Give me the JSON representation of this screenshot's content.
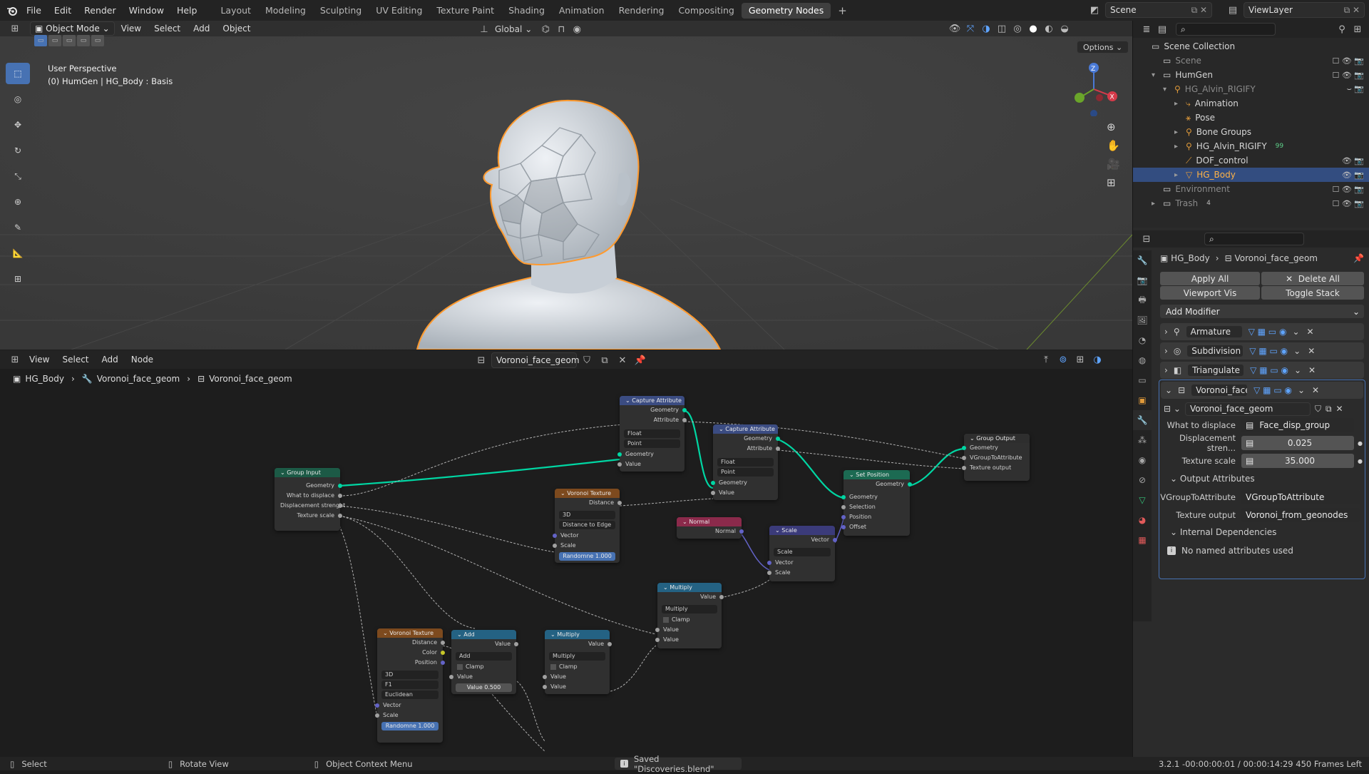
{
  "topbar": {
    "menus": [
      "File",
      "Edit",
      "Render",
      "Window",
      "Help"
    ],
    "workspaces": [
      "Layout",
      "Modeling",
      "Sculpting",
      "UV Editing",
      "Texture Paint",
      "Shading",
      "Animation",
      "Rendering",
      "Compositing",
      "Geometry Nodes"
    ],
    "active_workspace": "Geometry Nodes",
    "add_workspace": "+",
    "scene": "Scene",
    "view_layer": "ViewLayer"
  },
  "viewport": {
    "mode": "Object Mode",
    "menus": [
      "View",
      "Select",
      "Add",
      "Object"
    ],
    "orientation": "Global",
    "options": "Options",
    "overlay_line1": "User Perspective",
    "overlay_line2": "(0) HumGen | HG_Body : Basis"
  },
  "node_editor": {
    "menus": [
      "View",
      "Select",
      "Add",
      "Node"
    ],
    "tree_name": "Voronoi_face_geom",
    "breadcrumb": [
      "HG_Body",
      "Voronoi_face_geom",
      "Voronoi_face_geom"
    ]
  },
  "nodes": {
    "group_input": {
      "title": "Group Input",
      "outputs": [
        "Geometry",
        "What to displace",
        "Displacement strenght",
        "Texture scale"
      ]
    },
    "capture1": {
      "title": "Capture Attribute",
      "outputs": [
        "Geometry",
        "Attribute"
      ],
      "type": "Float",
      "domain": "Point",
      "inputs": [
        "Geometry",
        "Value"
      ]
    },
    "capture2": {
      "title": "Capture Attribute",
      "outputs": [
        "Geometry",
        "Attribute"
      ],
      "type": "Float",
      "domain": "Point",
      "inputs": [
        "Geometry",
        "Value"
      ]
    },
    "group_output": {
      "title": "Group Output",
      "inputs": [
        "Geometry",
        "VGroupToAttribute",
        "Texture output"
      ]
    },
    "voronoi1": {
      "title": "Voronoi Texture",
      "outputs": [
        "Distance"
      ],
      "dims": "3D",
      "feature": "Distance to Edge",
      "inputs": [
        "Vector",
        "Scale"
      ],
      "randomness": "Randomne  1.000"
    },
    "set_position": {
      "title": "Set Position",
      "outputs": [
        "Geometry"
      ],
      "inputs": [
        "Geometry",
        "Selection",
        "Position",
        "Offset"
      ]
    },
    "normal": {
      "title": "Normal",
      "outputs": [
        "Normal"
      ]
    },
    "scale": {
      "title": "Scale",
      "outputs": [
        "Vector"
      ],
      "op": "Scale",
      "inputs": [
        "Vector",
        "Scale"
      ]
    },
    "multiply_top": {
      "title": "Multiply",
      "outputs": [
        "Value"
      ],
      "op": "Multiply",
      "clamp": "Clamp",
      "inputs": [
        "Value",
        "Value"
      ]
    },
    "voronoi2": {
      "title": "Voronoi Texture",
      "outputs": [
        "Distance",
        "Color",
        "Position"
      ],
      "dims": "3D",
      "feature": "F1",
      "metric": "Euclidean",
      "inputs": [
        "Vector",
        "Scale"
      ],
      "randomness": "Randomne  1.000"
    },
    "add": {
      "title": "Add",
      "outputs": [
        "Value"
      ],
      "op": "Add",
      "clamp": "Clamp",
      "inputs": [
        "Value"
      ],
      "value": "Value   0.500"
    },
    "multiply_bottom": {
      "title": "Multiply",
      "outputs": [
        "Value"
      ],
      "op": "Multiply",
      "clamp": "Clamp",
      "inputs": [
        "Value",
        "Value"
      ]
    }
  },
  "outliner": {
    "rows": [
      {
        "label": "Scene Collection",
        "indent": 0,
        "icon": "collection-icon"
      },
      {
        "label": "Scene",
        "indent": 1,
        "icon": "collection-icon",
        "dim": true
      },
      {
        "label": "HumGen",
        "indent": 1,
        "icon": "collection-icon",
        "exp": "▾"
      },
      {
        "label": "HG_Alvin_RIGIFY",
        "indent": 2,
        "icon": "armature-icon",
        "exp": "▾",
        "dim": true
      },
      {
        "label": "Animation",
        "indent": 3,
        "icon": "animation-icon",
        "exp": "▸"
      },
      {
        "label": "Pose",
        "indent": 3,
        "icon": "pose-icon"
      },
      {
        "label": "Bone Groups",
        "indent": 3,
        "icon": "bone-groups-icon",
        "exp": "▸"
      },
      {
        "label": "HG_Alvin_RIGIFY",
        "indent": 3,
        "icon": "armature-data-icon",
        "exp": "▸"
      },
      {
        "label": "DOF_control",
        "indent": 3,
        "icon": "bone-icon"
      },
      {
        "label": "HG_Body",
        "indent": 3,
        "icon": "mesh-icon",
        "exp": "▸",
        "selected": true
      },
      {
        "label": "Environment",
        "indent": 1,
        "icon": "collection-icon",
        "dim": true
      },
      {
        "label": "Trash",
        "indent": 1,
        "icon": "collection-icon",
        "exp": "▸",
        "dim": true
      }
    ],
    "bone_count": "99",
    "trash_count": "4"
  },
  "properties": {
    "object": "HG_Body",
    "modifier_path": "Voronoi_face_geom",
    "apply_all": "Apply All",
    "delete_all": "Delete All",
    "viewport_vis": "Viewport Vis",
    "toggle_stack": "Toggle Stack",
    "add_modifier": "Add Modifier",
    "modifiers": [
      "Armature",
      "Subdivision",
      "Triangulate",
      "Voronoi_face_..."
    ],
    "node_group": "Voronoi_face_geom",
    "fields": [
      {
        "label": "What to displace",
        "value": "Face_disp_group"
      },
      {
        "label": "Displacement stren...",
        "value": "0.025"
      },
      {
        "label": "Texture scale",
        "value": "35.000"
      }
    ],
    "output_attributes": "Output Attributes",
    "outputs": [
      {
        "label": "VGroupToAttribute",
        "value": "VGroupToAttribute"
      },
      {
        "label": "Texture output",
        "value": "Voronoi_from_geonodes"
      }
    ],
    "internal_deps": "Internal Dependencies",
    "no_attrs": "No named attributes used"
  },
  "status": {
    "select": "Select",
    "rotate": "Rotate View",
    "context": "Object Context Menu",
    "saved": "Saved \"Discoveries.blend\"",
    "info": "3.2.1 -00:00:00:01 / 00:00:14:29  450 Frames Left"
  },
  "colors": {
    "accent": "#4772b3",
    "geometry_socket": "#00d6a3",
    "selection": "#334d80",
    "viewport_bg": "#3d3d3d",
    "outline": "#ff9a2e"
  }
}
